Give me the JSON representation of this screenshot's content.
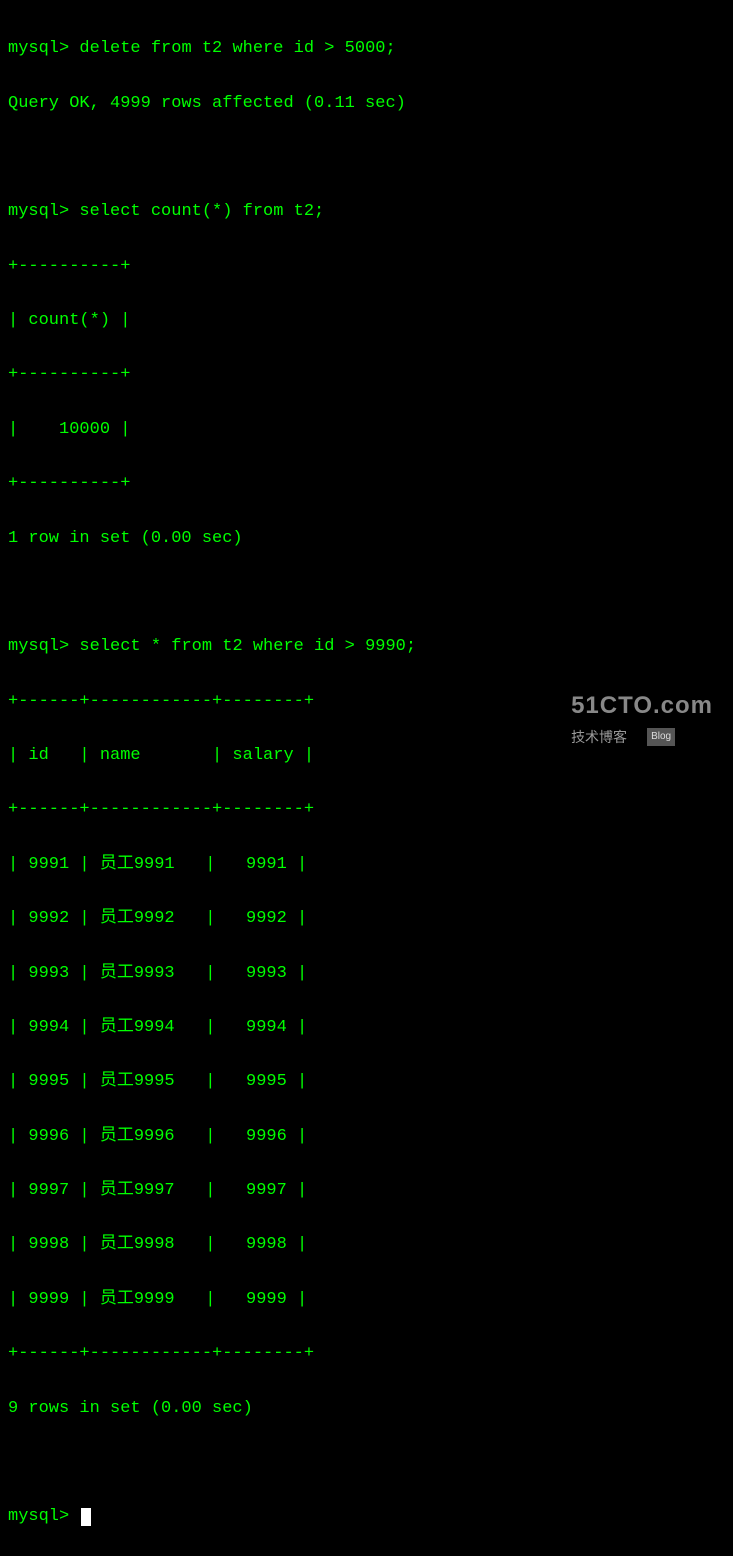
{
  "prompt": "mysql>",
  "commands": {
    "cmd1": "delete from t2 where id > 5000;",
    "response1": "Query OK, 4999 rows affected (0.11 sec)",
    "cmd2": "select count(*) from t2;",
    "table1_border_top": "+----------+",
    "table1_header": "| count(*) |",
    "table1_border_mid": "+----------+",
    "table1_row": "|    10000 |",
    "table1_border_bot": "+----------+",
    "response2": "1 row in set (0.00 sec)",
    "cmd3": "select * from t2 where id > 9990;",
    "table2_border_top": "+------+------------+--------+",
    "table2_header": "| id   | name       | salary |",
    "table2_border_mid": "+------+------------+--------+",
    "table2_rows": [
      "| 9991 | 员工9991   |   9991 |",
      "| 9992 | 员工9992   |   9992 |",
      "| 9993 | 员工9993   |   9993 |",
      "| 9994 | 员工9994   |   9994 |",
      "| 9995 | 员工9995   |   9995 |",
      "| 9996 | 员工9996   |   9996 |",
      "| 9997 | 员工9997   |   9997 |",
      "| 9998 | 员工9998   |   9998 |",
      "| 9999 | 员工9999   |   9999 |"
    ],
    "table2_border_bot": "+------+------------+--------+",
    "response3": "9 rows in set (0.00 sec)"
  },
  "watermark": {
    "main": "51CTO.com",
    "sub": "技术博客",
    "tag": "Blog"
  }
}
